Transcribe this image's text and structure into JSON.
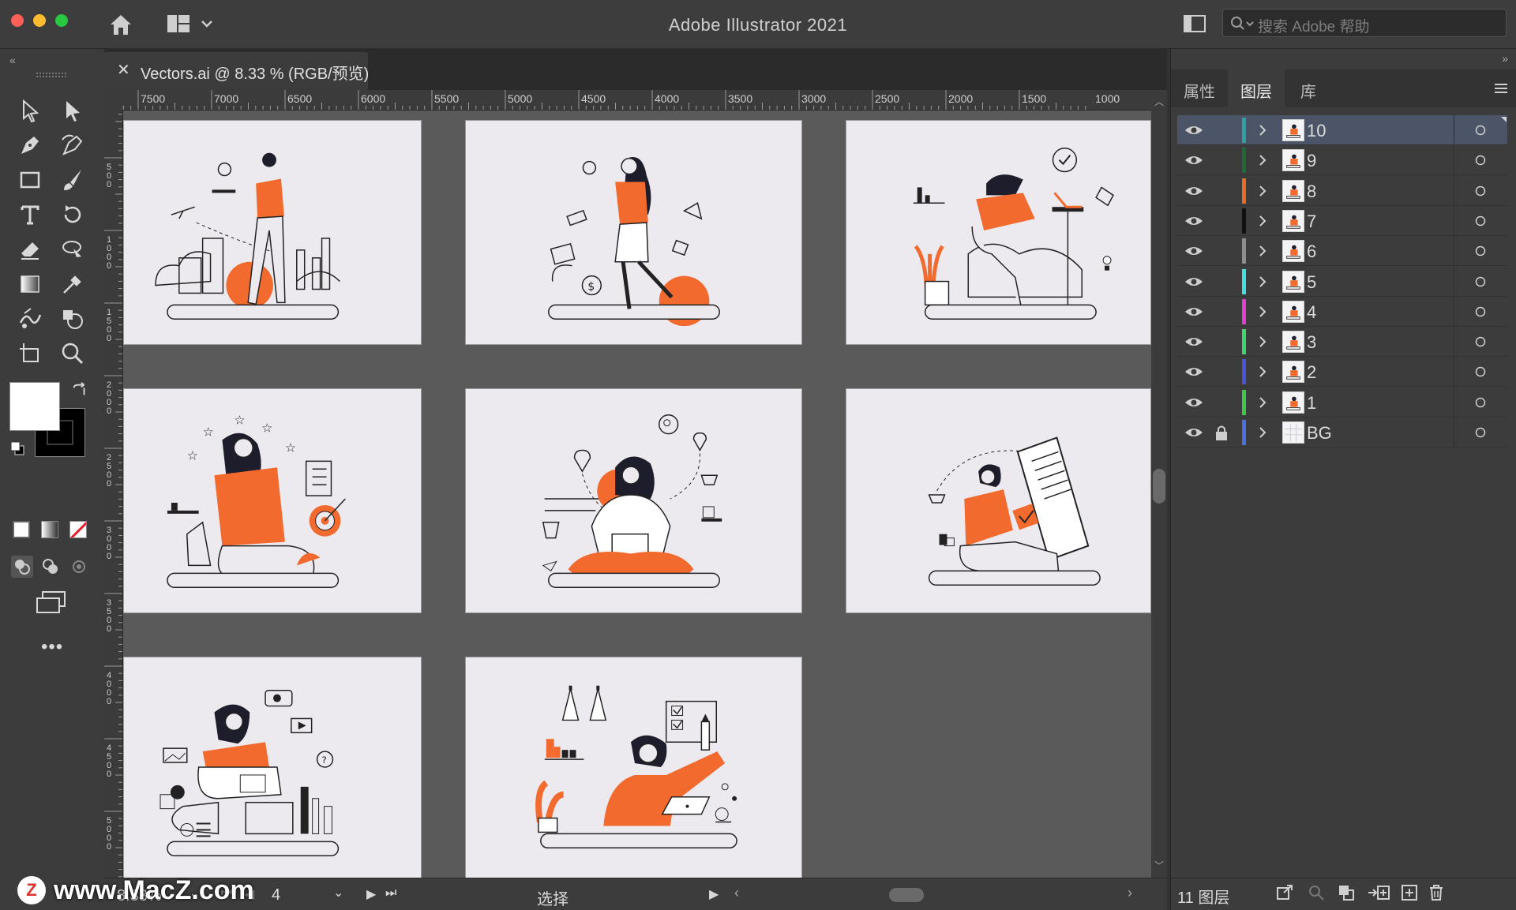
{
  "window": {
    "title": "Adobe Illustrator 2021",
    "search_placeholder": "搜索 Adobe 帮助"
  },
  "document_tab": {
    "label": "Vectors.ai @ 8.33 % (RGB/预览)"
  },
  "ruler": {
    "horizontal_labels": [
      "7500",
      "7000",
      "6500",
      "6000",
      "5500",
      "5000",
      "4500",
      "4000",
      "3500",
      "3000",
      "2500",
      "2000",
      "1500",
      "1000"
    ],
    "vertical_labels": [
      "500",
      "1000",
      "1500",
      "2000",
      "2500",
      "3000",
      "3500",
      "4000",
      "4500",
      "5000"
    ]
  },
  "panel": {
    "tabs": [
      "属性",
      "图层",
      "库"
    ],
    "active_tab": "图层",
    "layers": [
      {
        "name": "10",
        "color": "#2aa3a0",
        "selected": true,
        "locked": false
      },
      {
        "name": "9",
        "color": "#1f6b36",
        "selected": false,
        "locked": false
      },
      {
        "name": "8",
        "color": "#e86d24",
        "selected": false,
        "locked": false
      },
      {
        "name": "7",
        "color": "#111111",
        "selected": false,
        "locked": false
      },
      {
        "name": "6",
        "color": "#8e8e8e",
        "selected": false,
        "locked": false
      },
      {
        "name": "5",
        "color": "#3ee0e0",
        "selected": false,
        "locked": false
      },
      {
        "name": "4",
        "color": "#e23fd2",
        "selected": false,
        "locked": false
      },
      {
        "name": "3",
        "color": "#3cd96a",
        "selected": false,
        "locked": false
      },
      {
        "name": "2",
        "color": "#4a52d8",
        "selected": false,
        "locked": false
      },
      {
        "name": "1",
        "color": "#3cc94a",
        "selected": false,
        "locked": false
      },
      {
        "name": "BG",
        "color": "#4a6fe0",
        "selected": false,
        "locked": true
      }
    ],
    "footer_count": "11 图层"
  },
  "status": {
    "zoom": "8.33%",
    "artboard_number": "4",
    "tool_name": "选择"
  },
  "watermark": {
    "text": "www.MacZ.com",
    "logo_letter": "Z"
  },
  "colors": {
    "accent_orange": "#f26a2e",
    "artboard_bg": "#eceaef",
    "canvas_bg": "#5a5a5a",
    "selected_row": "#4b5567"
  }
}
